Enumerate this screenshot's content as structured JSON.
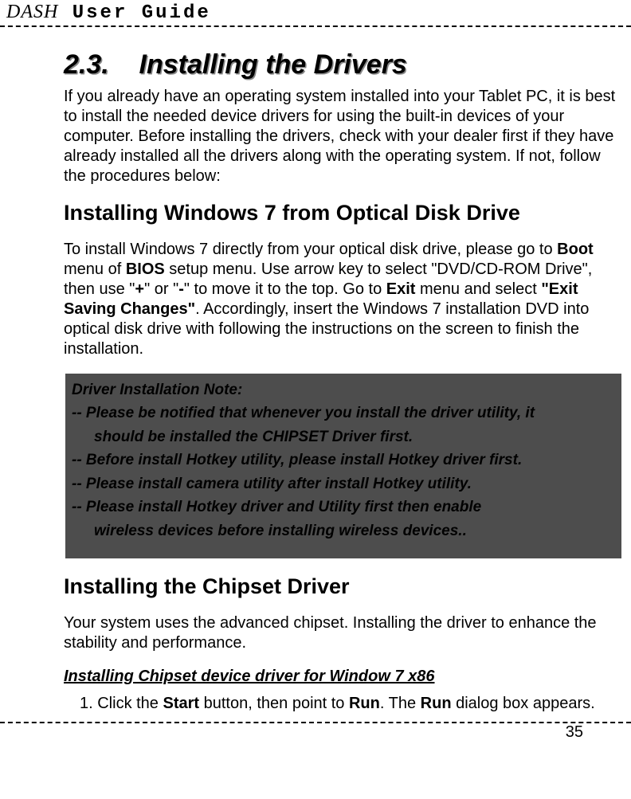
{
  "header": {
    "brand": "DASH",
    "title": "User Guide"
  },
  "section": {
    "number": "2.3.",
    "title": "Installing the Drivers",
    "intro": "If you already have an operating system installed into your Tablet PC, it is best to install the needed device drivers for using the built-in devices of your computer. Before installing the drivers, check with your dealer first if they have already installed all the drivers along with the operating system. If not, follow the procedures below:"
  },
  "sub1": {
    "title": "Installing Windows 7 from Optical Disk Drive",
    "para_parts": [
      "To install Windows 7 directly from your optical disk drive, please go to ",
      "Boot",
      " menu of ",
      "BIOS",
      " setup menu. Use arrow key to select \"DVD/CD-ROM Drive\", then use \"",
      "+",
      "\" or \"",
      "-",
      "\" to move it to the top. Go to ",
      "Exit",
      " menu and select ",
      "\"Exit Saving Changes\"",
      ". Accordingly, insert the Windows 7 installation DVD into optical disk drive with following the instructions on the screen to finish the installation."
    ]
  },
  "note": {
    "heading": "Driver Installation Note:",
    "l1a": "-- Please be notified that whenever you install the driver utility, it",
    "l1b": "should be installed the CHIPSET Driver first.",
    "l2": "-- Before install Hotkey utility, please install Hotkey driver first.",
    "l3": "-- Please install camera utility after install Hotkey utility.",
    "l4a": "-- Please install Hotkey driver and Utility first then enable",
    "l4b": "wireless devices before installing wireless devices.."
  },
  "sub2": {
    "title": "Installing the Chipset Driver",
    "para": "Your system uses the advanced chipset. Installing the driver to enhance the stability and performance.",
    "subsub": "Installing Chipset device driver for Window 7 x86",
    "step_parts": [
      "1.    Click the ",
      "Start",
      " button, then point to ",
      "Run",
      ". The ",
      "Run",
      " dialog box appears."
    ]
  },
  "page_number": "35"
}
